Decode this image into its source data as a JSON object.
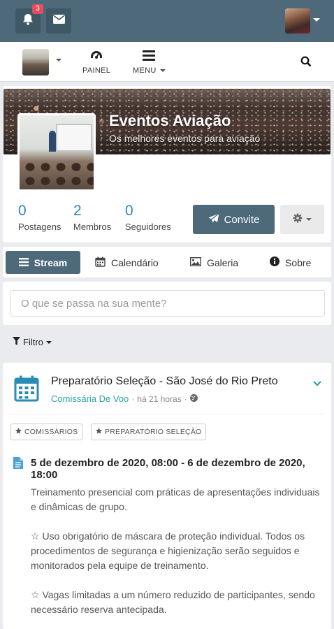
{
  "topbar": {
    "notification_count": "3",
    "colors": {
      "bar": "#4e6a7a",
      "button": "#3f5866",
      "badge": "#e84c5c"
    }
  },
  "navbar": {
    "painel_label": "PAINEL",
    "menu_label": "MENU"
  },
  "space": {
    "title": "Eventos Aviação",
    "subtitle": "Os melhores eventos para aviação",
    "stats": [
      {
        "value": "0",
        "label": "Postagens"
      },
      {
        "value": "2",
        "label": "Membros"
      },
      {
        "value": "0",
        "label": "Seguidores"
      }
    ],
    "invite_label": "Convite"
  },
  "tabs": [
    {
      "label": "Stream",
      "icon": "list-icon",
      "active": true
    },
    {
      "label": "Calendário",
      "icon": "calendar-icon",
      "active": false
    },
    {
      "label": "Galeria",
      "icon": "image-icon",
      "active": false
    },
    {
      "label": "Sobre",
      "icon": "info-icon",
      "active": false
    }
  ],
  "composer": {
    "placeholder": "O que se passa na sua mente?"
  },
  "filter": {
    "label": "Filtro"
  },
  "post": {
    "title": "Preparatório Seleção - São José do Rio Preto",
    "space_link": "Comissária De Voo",
    "separator": "·",
    "time": "há 21 horas",
    "separator2": "·",
    "tags": [
      "COMISSÁRIOS",
      "PREPARATÓRIO SELEÇÃO"
    ],
    "event_date": "5 de dezembro de 2020, 08:00 - 6 de dezembro de 2020, 18:00",
    "description": "Treinamento presencial com práticas de apresentações individuais e dinâmicas de grupo.\n\n☆ Uso obrigatório de máscara de proteção individual. Todos os procedimentos de segurança e higienização serão seguidos e monitorados pela equipe de treinamento.\n\n☆ Vagas limitadas a um número reduzido de participantes, sendo necessário reserva antecipada."
  },
  "colors": {
    "accent": "#2a8bb5",
    "teal_link": "#2aa3a3"
  }
}
